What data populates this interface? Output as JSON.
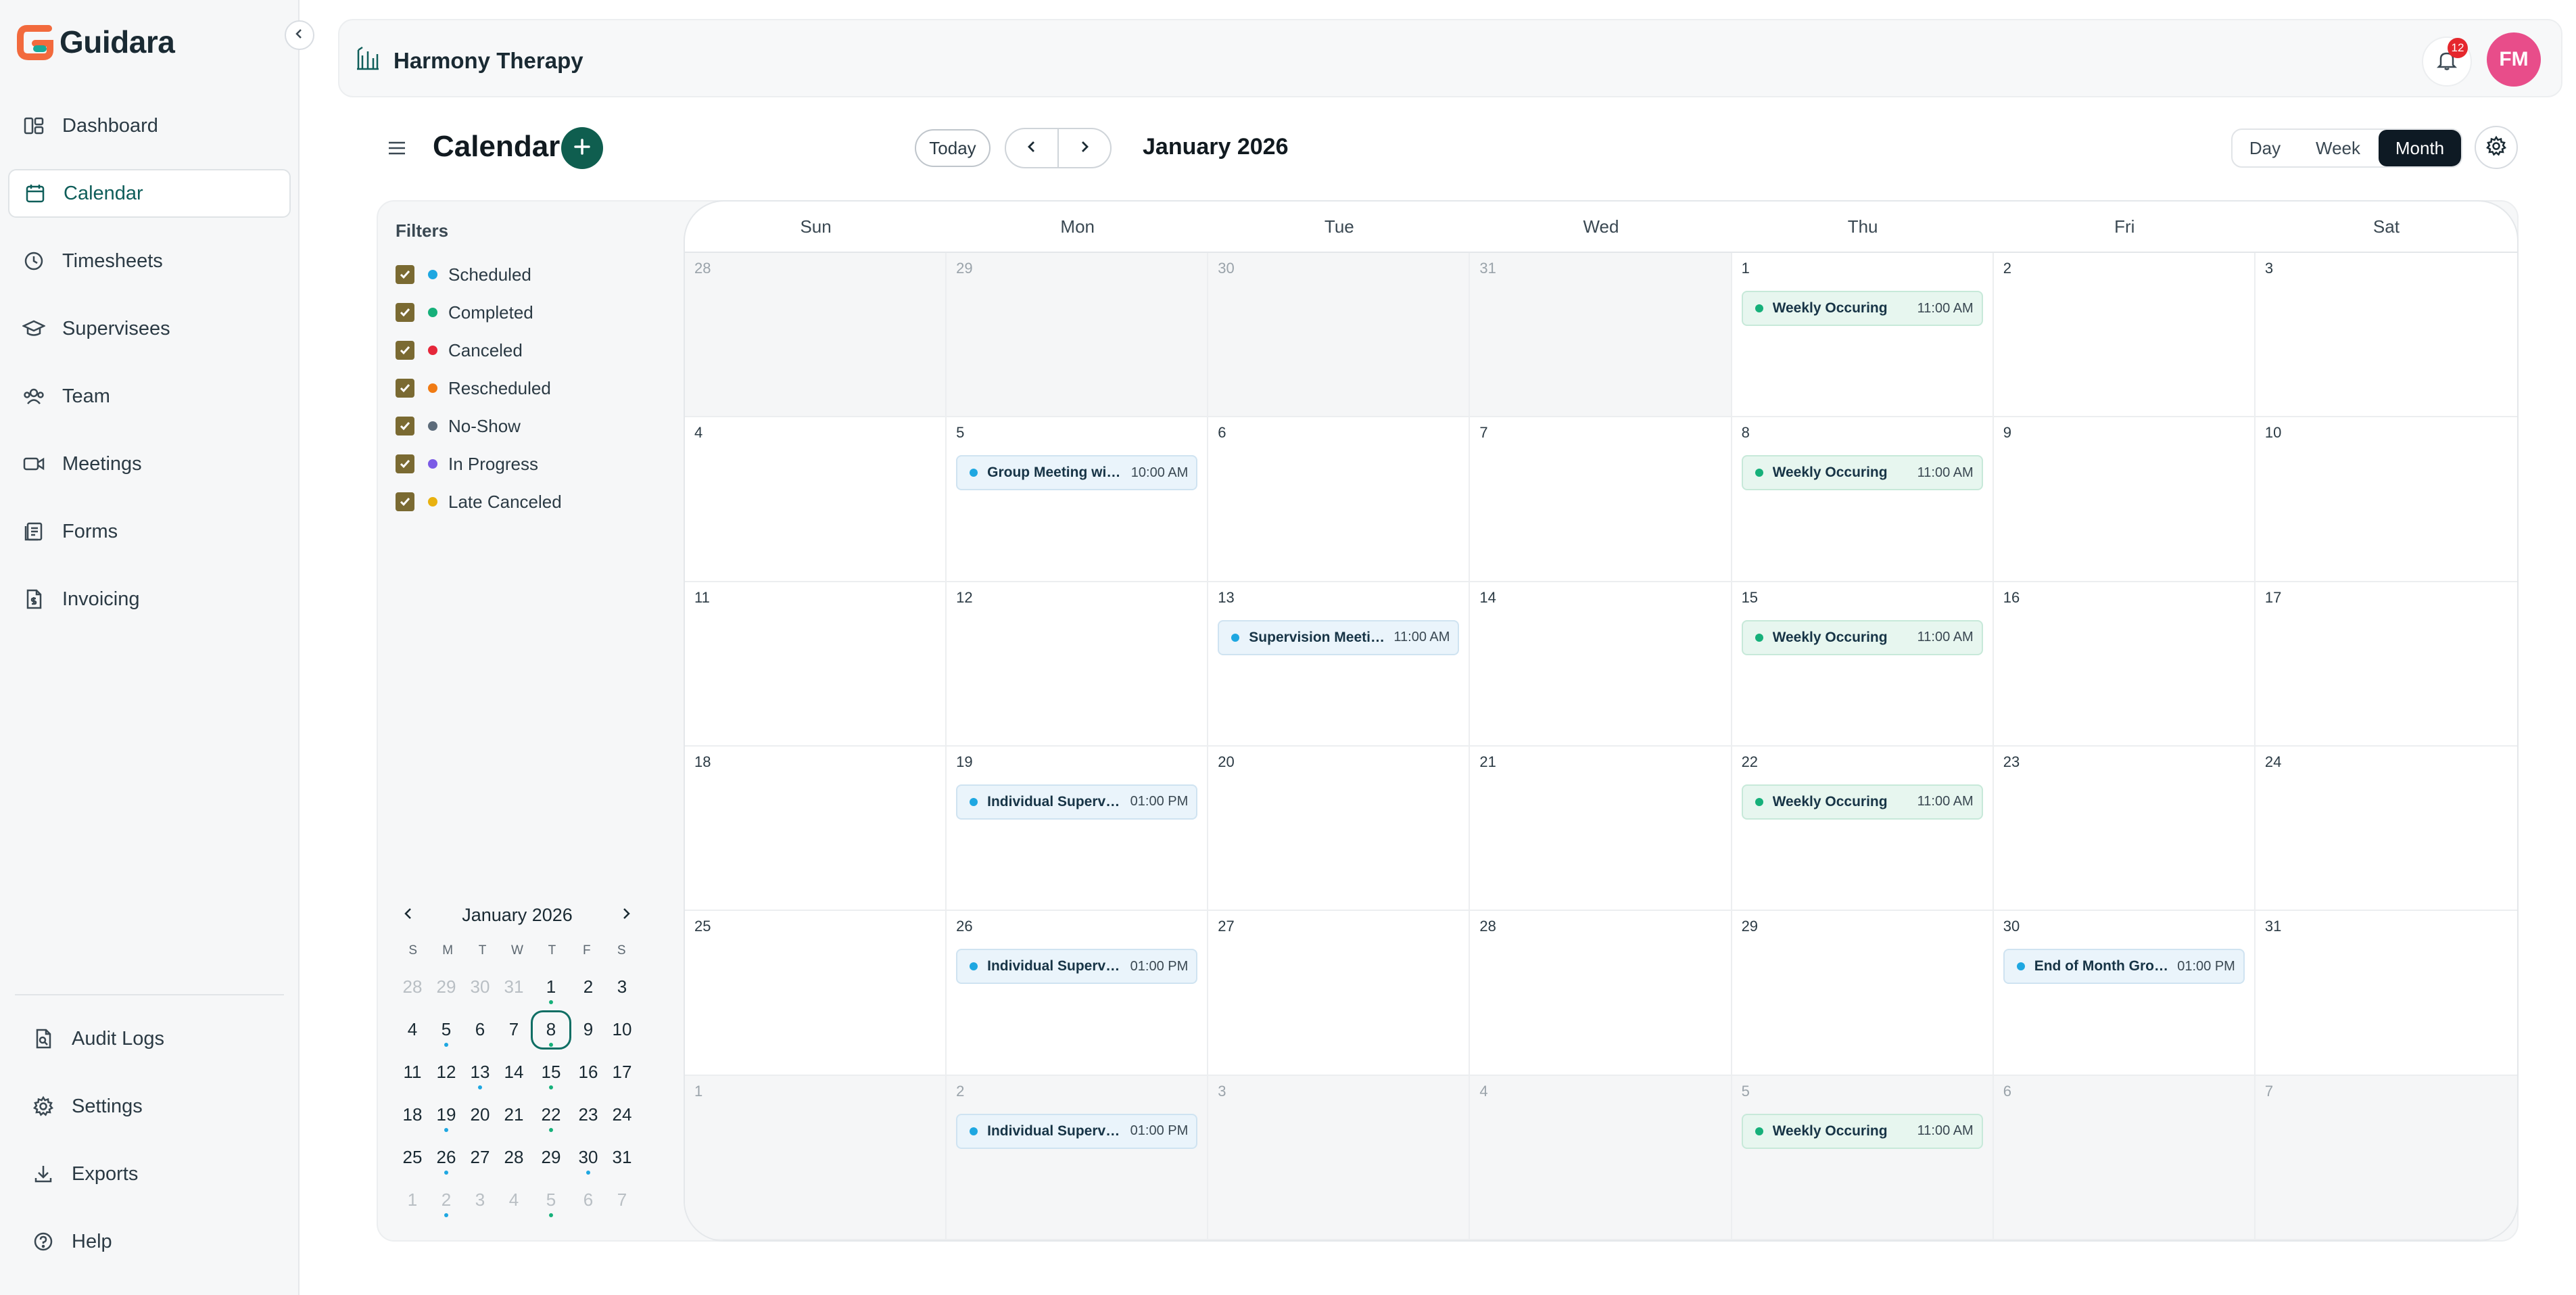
{
  "app": {
    "name": "Guidara"
  },
  "sidebar": {
    "items": [
      {
        "label": "Dashboard",
        "icon": "dashboard-icon"
      },
      {
        "label": "Calendar",
        "icon": "calendar-icon",
        "active": true
      },
      {
        "label": "Timesheets",
        "icon": "clock-icon"
      },
      {
        "label": "Supervisees",
        "icon": "graduation-cap-icon"
      },
      {
        "label": "Team",
        "icon": "users-icon"
      },
      {
        "label": "Meetings",
        "icon": "video-icon"
      },
      {
        "label": "Forms",
        "icon": "forms-icon"
      },
      {
        "label": "Invoicing",
        "icon": "invoice-icon"
      }
    ],
    "bottom": [
      {
        "label": "Audit Logs",
        "icon": "audit-icon"
      },
      {
        "label": "Settings",
        "icon": "gear-icon"
      },
      {
        "label": "Exports",
        "icon": "download-icon"
      },
      {
        "label": "Help",
        "icon": "help-icon"
      }
    ]
  },
  "topbar": {
    "org_name": "Harmony Therapy",
    "notification_count": "12",
    "avatar_initials": "FM"
  },
  "calendar": {
    "title": "Calendar",
    "today_label": "Today",
    "month_label": "January 2026",
    "views": {
      "day": "Day",
      "week": "Week",
      "month": "Month",
      "selected": "Month"
    },
    "weekdays": [
      "Sun",
      "Mon",
      "Tue",
      "Wed",
      "Thu",
      "Fri",
      "Sat"
    ]
  },
  "filters": {
    "title": "Filters",
    "items": [
      {
        "label": "Scheduled",
        "color": "#1ea7e1"
      },
      {
        "label": "Completed",
        "color": "#16b07a"
      },
      {
        "label": "Canceled",
        "color": "#e5273a"
      },
      {
        "label": "Rescheduled",
        "color": "#f07b14"
      },
      {
        "label": "No-Show",
        "color": "#5c6b7a"
      },
      {
        "label": "In Progress",
        "color": "#7b5be6"
      },
      {
        "label": "Late Canceled",
        "color": "#e8b10f"
      }
    ]
  },
  "mini_calendar": {
    "title": "January 2026",
    "dow": [
      "S",
      "M",
      "T",
      "W",
      "T",
      "F",
      "S"
    ],
    "selected": "8",
    "days": [
      {
        "n": "28",
        "muted": true
      },
      {
        "n": "29",
        "muted": true
      },
      {
        "n": "30",
        "muted": true
      },
      {
        "n": "31",
        "muted": true
      },
      {
        "n": "1",
        "ev": "#16b07a"
      },
      {
        "n": "2"
      },
      {
        "n": "3"
      },
      {
        "n": "4"
      },
      {
        "n": "5",
        "ev": "#1ea7e1"
      },
      {
        "n": "6"
      },
      {
        "n": "7"
      },
      {
        "n": "8",
        "ev": "#16b07a",
        "sel": true
      },
      {
        "n": "9"
      },
      {
        "n": "10"
      },
      {
        "n": "11"
      },
      {
        "n": "12"
      },
      {
        "n": "13",
        "ev": "#1ea7e1"
      },
      {
        "n": "14"
      },
      {
        "n": "15",
        "ev": "#16b07a"
      },
      {
        "n": "16"
      },
      {
        "n": "17"
      },
      {
        "n": "18"
      },
      {
        "n": "19",
        "ev": "#1ea7e1"
      },
      {
        "n": "20"
      },
      {
        "n": "21"
      },
      {
        "n": "22",
        "ev": "#16b07a"
      },
      {
        "n": "23"
      },
      {
        "n": "24"
      },
      {
        "n": "25"
      },
      {
        "n": "26",
        "ev": "#1ea7e1"
      },
      {
        "n": "27"
      },
      {
        "n": "28"
      },
      {
        "n": "29"
      },
      {
        "n": "30",
        "ev": "#1ea7e1"
      },
      {
        "n": "31"
      },
      {
        "n": "1",
        "muted": true
      },
      {
        "n": "2",
        "muted": true,
        "ev": "#1ea7e1"
      },
      {
        "n": "3",
        "muted": true
      },
      {
        "n": "4",
        "muted": true
      },
      {
        "n": "5",
        "muted": true,
        "ev": "#16b07a"
      },
      {
        "n": "6",
        "muted": true
      },
      {
        "n": "7",
        "muted": true
      }
    ]
  },
  "month_grid": {
    "cells": [
      {
        "n": "28",
        "out": true
      },
      {
        "n": "29",
        "out": true
      },
      {
        "n": "30",
        "out": true
      },
      {
        "n": "31",
        "out": true
      },
      {
        "n": "1",
        "event": {
          "title": "Weekly Occuring",
          "time": "11:00 AM",
          "color": "green"
        }
      },
      {
        "n": "2"
      },
      {
        "n": "3"
      },
      {
        "n": "4"
      },
      {
        "n": "5",
        "event": {
          "title": "Group Meeting with Supervisees",
          "time": "10:00 AM",
          "color": "blue"
        }
      },
      {
        "n": "6"
      },
      {
        "n": "7"
      },
      {
        "n": "8",
        "event": {
          "title": "Weekly Occuring",
          "time": "11:00 AM",
          "color": "green"
        }
      },
      {
        "n": "9"
      },
      {
        "n": "10"
      },
      {
        "n": "11"
      },
      {
        "n": "12"
      },
      {
        "n": "13",
        "event": {
          "title": "Supervision Meeting",
          "time": "11:00 AM",
          "color": "blue"
        }
      },
      {
        "n": "14"
      },
      {
        "n": "15",
        "event": {
          "title": "Weekly Occuring",
          "time": "11:00 AM",
          "color": "green"
        }
      },
      {
        "n": "16"
      },
      {
        "n": "17"
      },
      {
        "n": "18"
      },
      {
        "n": "19",
        "event": {
          "title": "Individual Supervision",
          "time": "01:00 PM",
          "color": "blue"
        }
      },
      {
        "n": "20"
      },
      {
        "n": "21"
      },
      {
        "n": "22",
        "event": {
          "title": "Weekly Occuring",
          "time": "11:00 AM",
          "color": "green"
        }
      },
      {
        "n": "23"
      },
      {
        "n": "24"
      },
      {
        "n": "25"
      },
      {
        "n": "26",
        "event": {
          "title": "Individual Supervision",
          "time": "01:00 PM",
          "color": "blue"
        }
      },
      {
        "n": "27"
      },
      {
        "n": "28"
      },
      {
        "n": "29"
      },
      {
        "n": "30",
        "event": {
          "title": "End of Month Group",
          "time": "01:00 PM",
          "color": "blue"
        }
      },
      {
        "n": "31"
      },
      {
        "n": "1",
        "out": true
      },
      {
        "n": "2",
        "out": true,
        "event": {
          "title": "Individual Supervision",
          "time": "01:00 PM",
          "color": "blue"
        }
      },
      {
        "n": "3",
        "out": true
      },
      {
        "n": "4",
        "out": true
      },
      {
        "n": "5",
        "out": true,
        "event": {
          "title": "Weekly Occuring",
          "time": "11:00 AM",
          "color": "green"
        }
      },
      {
        "n": "6",
        "out": true
      },
      {
        "n": "7",
        "out": true
      }
    ]
  }
}
